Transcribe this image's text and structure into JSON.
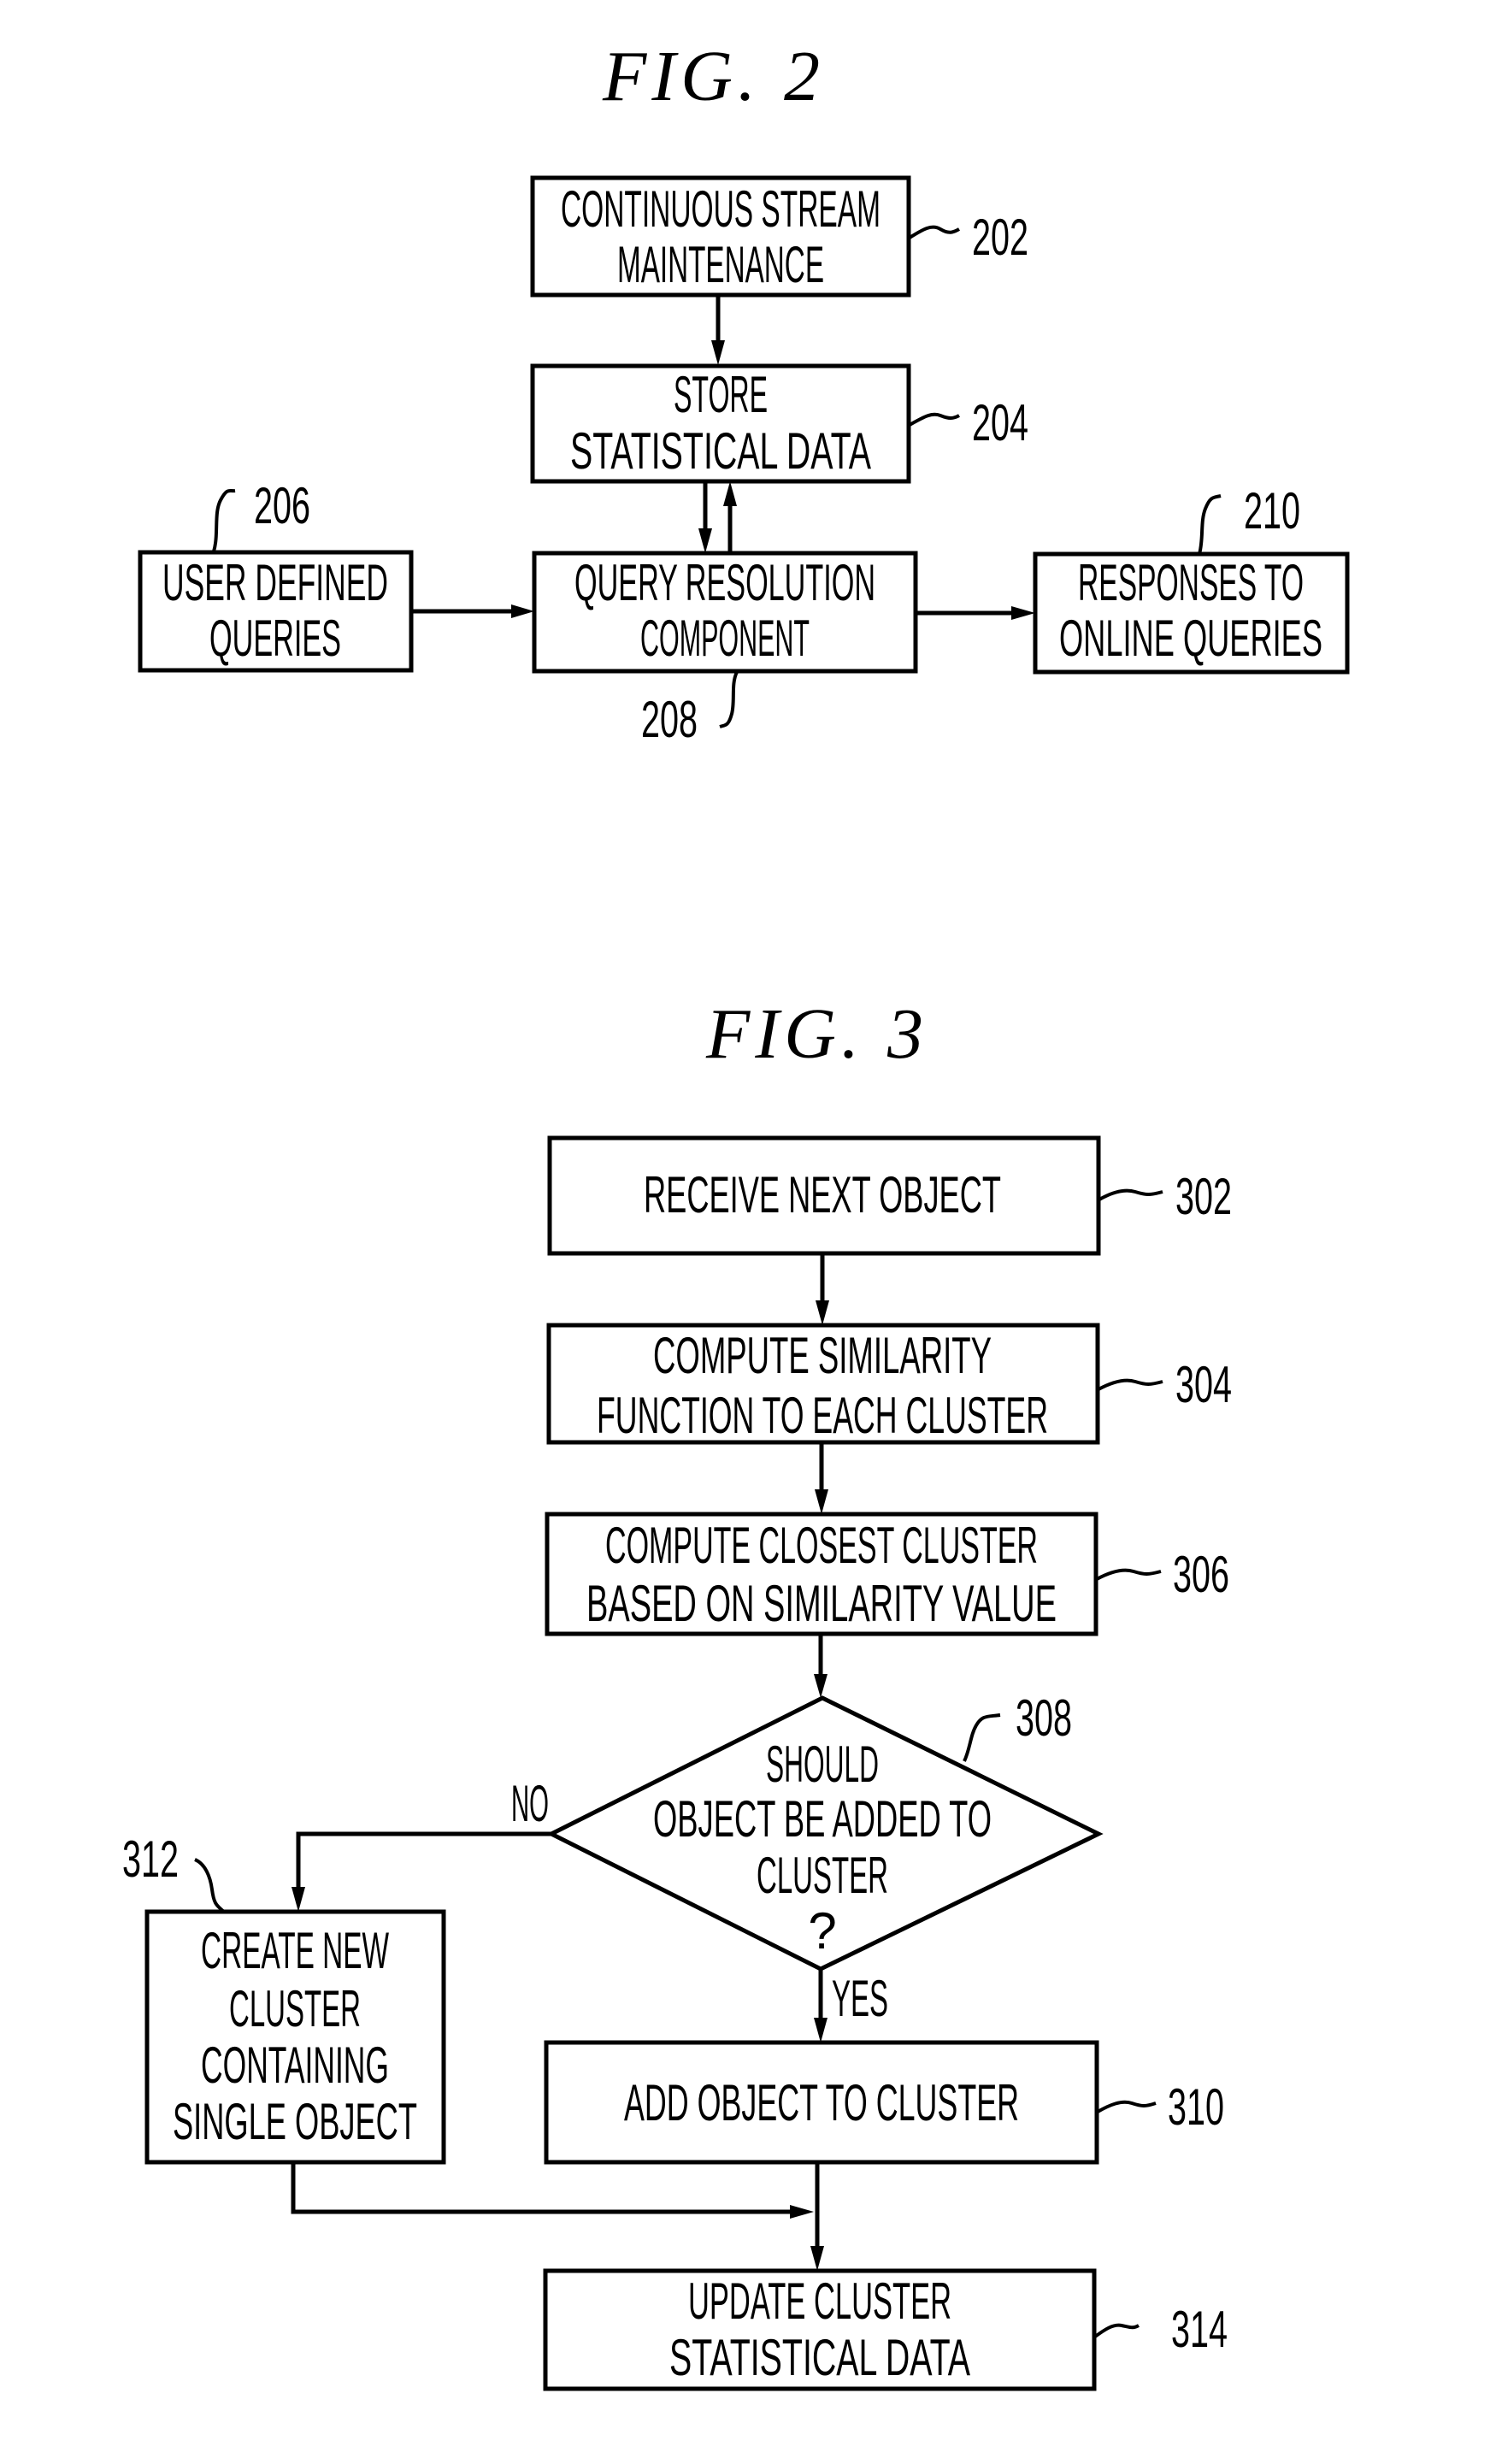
{
  "figures": [
    {
      "title": "FIG. 2",
      "nodes": [
        {
          "id": "202",
          "shape": "box",
          "lines": [
            "CONTINUOUS STREAM",
            "MAINTENANCE"
          ]
        },
        {
          "id": "204",
          "shape": "box",
          "lines": [
            "STORE",
            "STATISTICAL DATA"
          ]
        },
        {
          "id": "206",
          "shape": "box",
          "lines": [
            "USER DEFINED",
            "QUERIES"
          ]
        },
        {
          "id": "208",
          "shape": "box",
          "lines": [
            "QUERY RESOLUTION",
            "COMPONENT"
          ]
        },
        {
          "id": "210",
          "shape": "box",
          "lines": [
            "RESPONSES TO",
            "ONLINE QUERIES"
          ]
        }
      ],
      "edges": [
        {
          "from": "202",
          "to": "204"
        },
        {
          "from": "204",
          "to": "208"
        },
        {
          "from": "208",
          "to": "204"
        },
        {
          "from": "206",
          "to": "208"
        },
        {
          "from": "208",
          "to": "210"
        }
      ]
    },
    {
      "title": "FIG. 3",
      "nodes": [
        {
          "id": "302",
          "shape": "box",
          "lines": [
            "RECEIVE NEXT OBJECT"
          ]
        },
        {
          "id": "304",
          "shape": "box",
          "lines": [
            "COMPUTE SIMILARITY",
            "FUNCTION TO EACH CLUSTER"
          ]
        },
        {
          "id": "306",
          "shape": "box",
          "lines": [
            "COMPUTE CLOSEST CLUSTER",
            "BASED ON SIMILARITY VALUE"
          ]
        },
        {
          "id": "308",
          "shape": "diamond",
          "lines": [
            "SHOULD",
            "OBJECT BE ADDED TO",
            "CLUSTER",
            "?"
          ]
        },
        {
          "id": "310",
          "shape": "box",
          "lines": [
            "ADD OBJECT TO CLUSTER"
          ]
        },
        {
          "id": "312",
          "shape": "box",
          "lines": [
            "CREATE NEW",
            "CLUSTER",
            "CONTAINING",
            "SINGLE OBJECT"
          ]
        },
        {
          "id": "314",
          "shape": "box",
          "lines": [
            "UPDATE CLUSTER",
            "STATISTICAL DATA"
          ]
        }
      ],
      "edges": [
        {
          "from": "302",
          "to": "304"
        },
        {
          "from": "304",
          "to": "306"
        },
        {
          "from": "306",
          "to": "308"
        },
        {
          "from": "308",
          "to": "312",
          "label": "NO"
        },
        {
          "from": "308",
          "to": "310",
          "label": "YES"
        },
        {
          "from": "310",
          "to": "314"
        },
        {
          "from": "312",
          "to": "314"
        }
      ]
    }
  ]
}
